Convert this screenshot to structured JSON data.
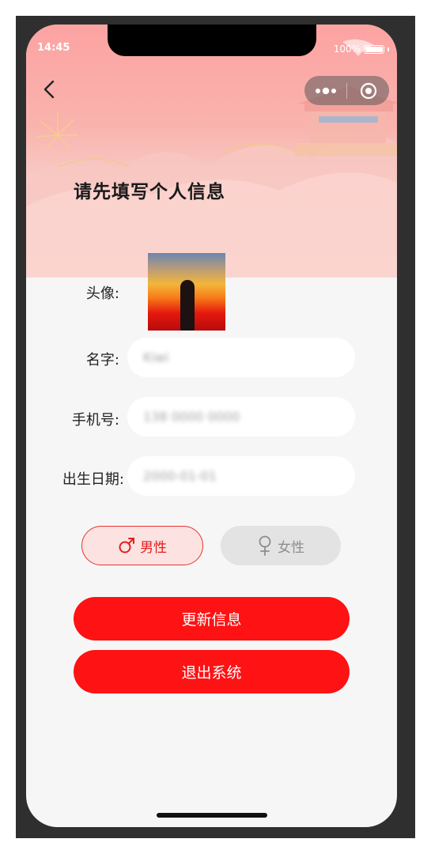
{
  "status_bar": {
    "time": "14:45",
    "battery": "100%"
  },
  "nav": {
    "back_icon": "chevron-left-icon",
    "more_icon": "more-dots-icon",
    "close_icon": "target-icon"
  },
  "page": {
    "title": "请先填写个人信息"
  },
  "form": {
    "avatar_label": "头像:",
    "name_label": "名字:",
    "name_value": "Kiwi",
    "phone_label": "手机号:",
    "phone_value": "138 0000 0000",
    "birth_label": "出生日期:",
    "birth_value": "2000-01-01"
  },
  "gender": {
    "male_label": "男性",
    "female_label": "女性",
    "selected": "male"
  },
  "actions": {
    "update_label": "更新信息",
    "logout_label": "退出系统"
  },
  "colors": {
    "primary": "#fe1214",
    "male_accent": "#e0201c",
    "female_inactive": "#8d8d8d"
  }
}
